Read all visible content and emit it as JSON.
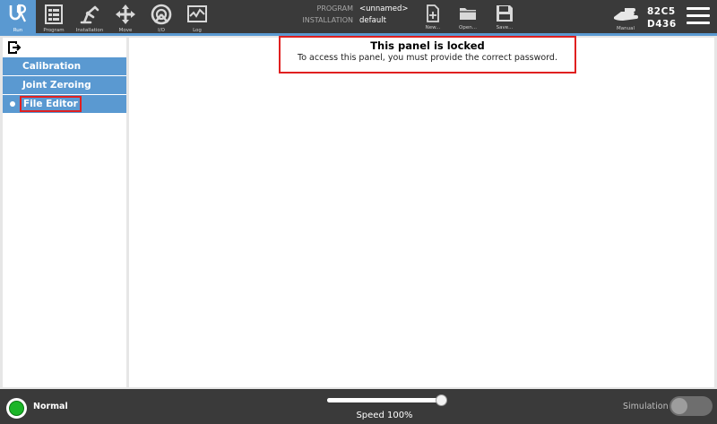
{
  "header": {
    "nav": [
      {
        "label": "Run",
        "icon": "ur-logo-icon",
        "active": true
      },
      {
        "label": "Program",
        "icon": "program-icon"
      },
      {
        "label": "Installation",
        "icon": "installation-icon"
      },
      {
        "label": "Move",
        "icon": "move-icon"
      },
      {
        "label": "I/O",
        "icon": "io-icon"
      },
      {
        "label": "Log",
        "icon": "log-icon"
      }
    ],
    "program_key": "PROGRAM",
    "program_value": "<unnamed>",
    "installation_key": "INSTALLATION",
    "installation_value": "default",
    "file_buttons": [
      {
        "label": "New...",
        "icon": "new-file-icon"
      },
      {
        "label": "Open...",
        "icon": "open-folder-icon"
      },
      {
        "label": "Save...",
        "icon": "save-icon"
      }
    ],
    "mode_label": "Manual",
    "robot_id_line1": "82C5",
    "robot_id_line2": "D436"
  },
  "sidebar": {
    "items": [
      {
        "label": "Calibration"
      },
      {
        "label": "Joint Zeroing"
      },
      {
        "label": "File Editor",
        "selected": true
      }
    ]
  },
  "main": {
    "lock_title": "This panel is locked",
    "lock_message": "To access this panel, you must provide the correct password."
  },
  "footer": {
    "status_label": "Normal",
    "speed_label": "Speed 100%",
    "speed_value": 1.0,
    "simulation_label": "Simulation",
    "simulation_on": false
  },
  "colors": {
    "accent": "#5a99d1",
    "bar_background": "#3a3a3a",
    "highlight_border": "#e02020",
    "status_ok": "#1bb528"
  }
}
